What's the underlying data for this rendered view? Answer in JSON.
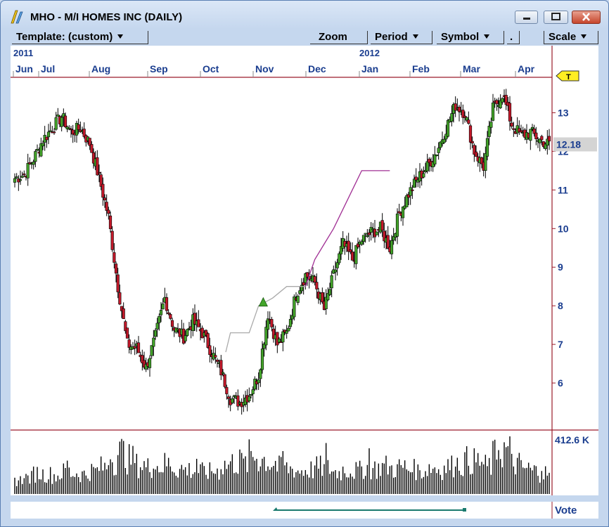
{
  "window": {
    "title": "MHO - M/I HOMES INC (DAILY)"
  },
  "toolbar": {
    "template_label": "Template: (custom)",
    "zoom_label": "Zoom",
    "period_label": "Period",
    "symbol_label": "Symbol",
    "dot_label": ".",
    "scale_label": "Scale"
  },
  "footer": {
    "vote_label": "Vote"
  },
  "colors": {
    "up_candle": "#43a52a",
    "down_candle": "#c4192a",
    "axis_line": "#9a1b2a",
    "axis_text": "#1a3d8f",
    "stop_line_gray": "#aaaaaa",
    "stop_line_purple": "#a02f94",
    "marker_yellow": "#ffee22",
    "volume": "#000000"
  },
  "chart_data": [
    {
      "type": "candlestick",
      "title": "",
      "x_axis": {
        "year_labels": [
          "2011",
          "2012"
        ],
        "month_labels": [
          "Jun",
          "Jul",
          "Aug",
          "Sep",
          "Oct",
          "Nov",
          "Dec",
          "Jan",
          "Feb",
          "Mar",
          "Apr"
        ]
      },
      "y_axis": {
        "ticks": [
          6,
          7,
          8,
          9,
          10,
          11,
          12,
          13
        ],
        "ylim": [
          4.8,
          13.9
        ],
        "position": "right"
      },
      "last_price_label": "12.18",
      "last_price": 12.18,
      "marker_label": "T",
      "grid": false,
      "weekly_closes": [
        11.3,
        11.4,
        11.8,
        12.3,
        12.6,
        12.9,
        12.5,
        12.6,
        12.2,
        11.3,
        10.3,
        8.5,
        7.0,
        6.9,
        6.4,
        7.2,
        8.2,
        7.4,
        7.2,
        7.6,
        7.3,
        6.8,
        6.3,
        5.6,
        5.5,
        5.7,
        6.2,
        7.8,
        7.0,
        7.3,
        8.3,
        8.8,
        8.6,
        7.9,
        8.8,
        9.6,
        9.2,
        9.7,
        9.9,
        10.0,
        9.5,
        10.4,
        10.9,
        11.3,
        11.6,
        12.0,
        12.6,
        13.2,
        13.0,
        12.0,
        11.6,
        13.1,
        13.5,
        12.7,
        12.4,
        12.5,
        12.3,
        12.18
      ],
      "trailing_stop": {
        "gray": [
          [
            22.5,
            6.8
          ],
          [
            23,
            7.3
          ],
          [
            25,
            7.3
          ],
          [
            26,
            8.0
          ],
          [
            27.5,
            8.2
          ],
          [
            29,
            8.5
          ],
          [
            31,
            8.5
          ]
        ],
        "purple": [
          [
            31,
            8.5
          ],
          [
            32,
            9.2
          ],
          [
            33,
            9.6
          ],
          [
            34,
            10.0
          ],
          [
            35,
            10.5
          ],
          [
            36,
            11.0
          ],
          [
            37,
            11.5
          ],
          [
            40,
            11.5
          ]
        ]
      }
    },
    {
      "type": "bar",
      "title": "",
      "y_axis": {
        "max_label": "412.6 K",
        "max": 412600
      },
      "unit": "shares",
      "weekly_volume_k": [
        120,
        140,
        180,
        170,
        160,
        190,
        180,
        170,
        200,
        230,
        290,
        360,
        300,
        250,
        230,
        240,
        260,
        220,
        210,
        200,
        190,
        200,
        250,
        270,
        260,
        330,
        300,
        270,
        230,
        220,
        200,
        210,
        230,
        220,
        190,
        210,
        200,
        230,
        220,
        240,
        220,
        230,
        210,
        200,
        230,
        220,
        240,
        260,
        290,
        280,
        240,
        330,
        380,
        260,
        220,
        200,
        180,
        160
      ]
    }
  ]
}
